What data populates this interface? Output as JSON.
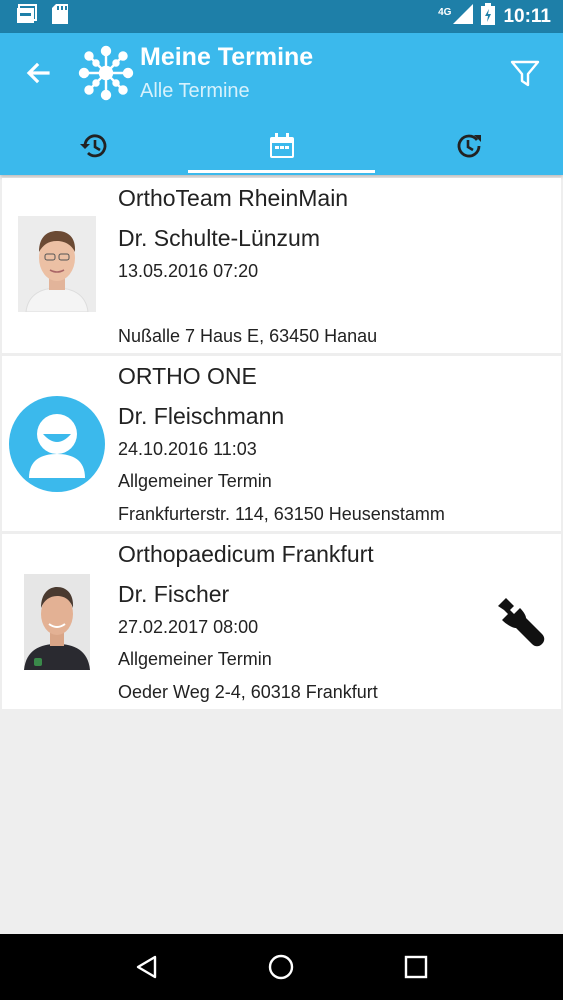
{
  "status_bar": {
    "time": "10:11",
    "network": "4G"
  },
  "app_bar": {
    "title": "Meine Termine",
    "subtitle": "Alle Termine"
  },
  "tabs": [
    {
      "icon": "history-icon",
      "active": false
    },
    {
      "icon": "calendar-icon",
      "active": true
    },
    {
      "icon": "upcoming-clock-icon",
      "active": false
    }
  ],
  "appointments": [
    {
      "practice": "OrthoTeam RheinMain",
      "doctor": "Dr. Schulte-Lünzum",
      "datetime": "13.05.2016 07:20",
      "type": "",
      "address": "Nußalle 7 Haus E, 63450 Hanau",
      "avatar": "doctor-photo"
    },
    {
      "practice": "ORTHO ONE",
      "doctor": "Dr. Fleischmann",
      "datetime": "24.10.2016 11:03",
      "type": "Allgemeiner Termin",
      "address": "Frankfurterstr. 114, 63150 Heusenstamm",
      "avatar": "placeholder-person-icon"
    },
    {
      "practice": "Orthopaedicum Frankfurt",
      "doctor": "Dr. Fischer",
      "datetime": "27.02.2017 08:00",
      "type": "Allgemeiner Termin",
      "address": "Oeder Weg 2-4, 60318 Frankfurt",
      "avatar": "doctor-photo",
      "action_icon": "wrench-icon"
    }
  ],
  "colors": {
    "primary": "#3bb9ec",
    "status_bar": "#1e7fa8",
    "background": "#eeeeee"
  }
}
